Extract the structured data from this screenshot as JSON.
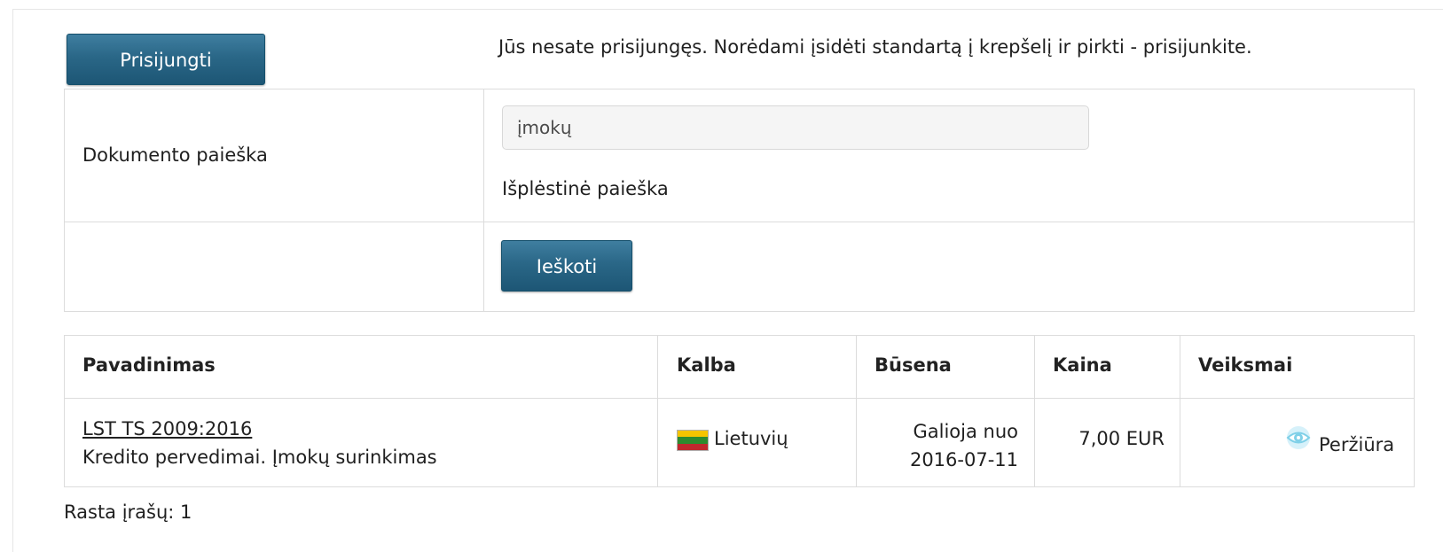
{
  "header": {
    "login_label": "Prisijungti",
    "notice": "Jūs nesate prisijungęs. Norėdami įsidėti standartą į krepšelį ir pirkti - prisijunkite."
  },
  "search": {
    "label": "Dokumento paieška",
    "input_value": "įmokų",
    "advanced_label": "Išplėstinė paieška",
    "submit_label": "Ieškoti"
  },
  "results": {
    "columns": [
      "Pavadinimas",
      "Kalba",
      "Būsena",
      "Kaina",
      "Veiksmai"
    ],
    "rows": [
      {
        "code": "LST TS 2009:2016",
        "title": "Kredito pervedimai. Įmokų surinkimas",
        "language": "Lietuvių",
        "language_flag": "lithuania-flag-icon",
        "status_line1": "Galioja nuo",
        "status_line2": "2016-07-11",
        "price": "7,00 EUR",
        "action_icon": "eye-icon",
        "action_label": "Peržiūra"
      }
    ],
    "count_text": "Rasta įrašų: 1"
  },
  "colors": {
    "button": "#2a6787",
    "border": "#dcdcdc",
    "flag_yellow": "#f5c400",
    "flag_green": "#2e8b2e",
    "flag_red": "#c1272d",
    "eye_accent": "#7fd0e8"
  }
}
